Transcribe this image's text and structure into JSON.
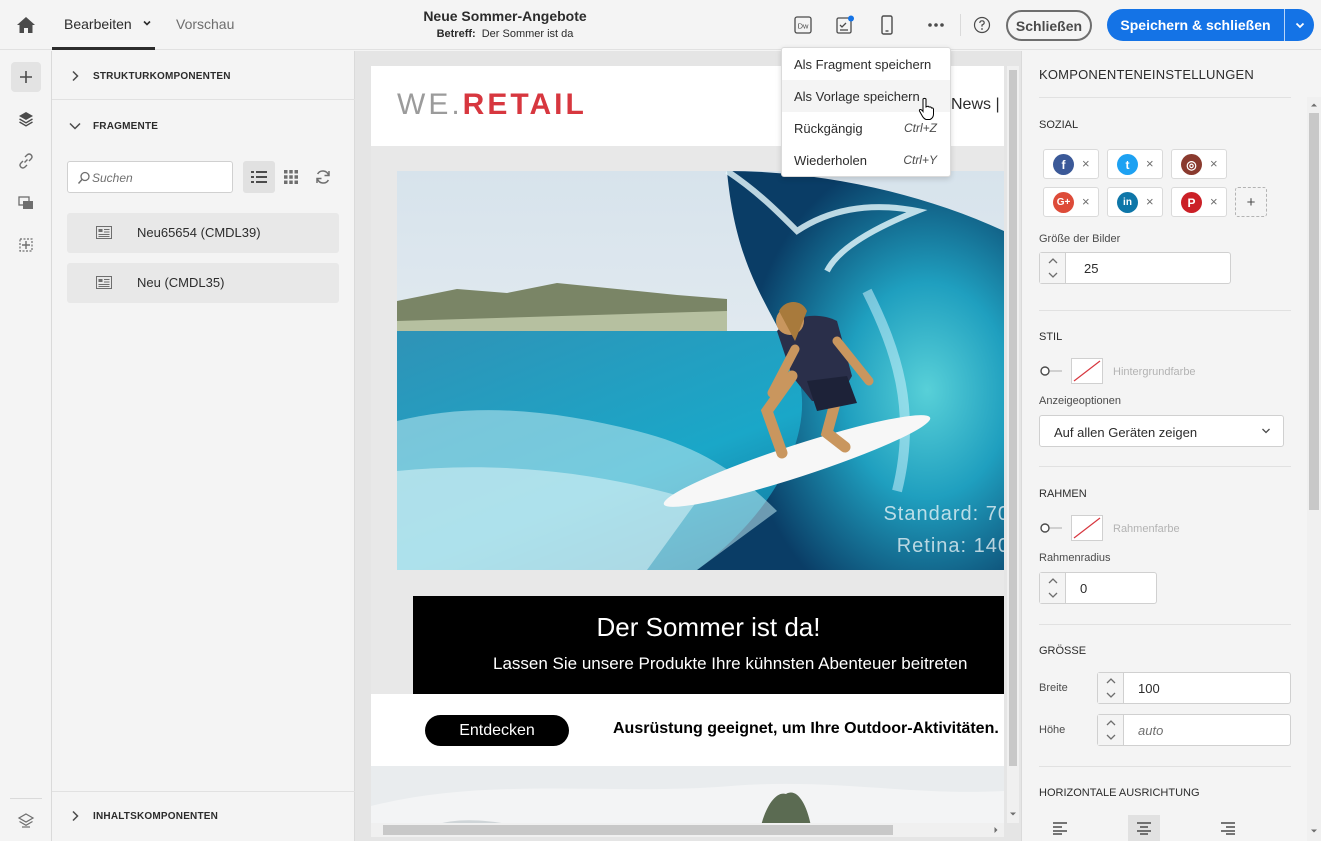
{
  "topbar": {
    "tab_edit": "Bearbeiten",
    "tab_preview": "Vorschau",
    "title": "Neue Sommer-Angebote",
    "subject_label": "Betreff:",
    "subject_value": "Der Sommer ist da",
    "dw_icon_text": "Dw",
    "close_label": "Schließen",
    "save_label": "Speichern & schließen",
    "accent": "#1473e6"
  },
  "left_panel": {
    "structure_heading": "STRUKTURKOMPONENTEN",
    "fragments_heading": "FRAGMENTE",
    "search_placeholder": "Suchen",
    "fragments": [
      {
        "label": "Neu65654 (CMDL39)"
      },
      {
        "label": "Neu (CMDL35)"
      }
    ],
    "content_heading": "INHALTSKOMPONENTEN"
  },
  "email": {
    "logo_left": "WE.",
    "logo_right": "RETAIL",
    "nav_text": "News |",
    "hero_text_1": "Standard: 70",
    "hero_text_2": "Retina: 140",
    "headline": "Der Sommer ist da!",
    "subline": "Lassen Sie unsere Produkte Ihre kühnsten Abenteuer beitreten",
    "cta_label": "Entdecken",
    "cta_description": "Ausrüstung geeignet, um Ihre Outdoor-Aktivitäten."
  },
  "menu": {
    "items": [
      {
        "label": "Als Fragment speichern",
        "shortcut": ""
      },
      {
        "label": "Als Vorlage speichern",
        "shortcut": ""
      },
      {
        "label": "Rückgängig",
        "shortcut": "Ctrl+Z"
      },
      {
        "label": "Wiederholen",
        "shortcut": "Ctrl+Y"
      }
    ]
  },
  "right_panel": {
    "title": "KOMPONENTENEINSTELLUNGEN",
    "social_heading": "SOZIAL",
    "social": [
      {
        "name": "facebook",
        "glyph": "f",
        "color": "#3b5998"
      },
      {
        "name": "twitter",
        "glyph": "t",
        "color": "#1da1f2"
      },
      {
        "name": "instagram",
        "glyph": "◎",
        "color": "#8a3a2e"
      },
      {
        "name": "google-plus",
        "glyph": "G+",
        "color": "#dd4b39"
      },
      {
        "name": "linkedin",
        "glyph": "in",
        "color": "#0e76a8"
      },
      {
        "name": "pinterest",
        "glyph": "P",
        "color": "#cb2027"
      }
    ],
    "social_add": "+",
    "image_size_label": "Größe der Bilder",
    "image_size_value": "25",
    "style_heading": "STIL",
    "bg_color_label": "Hintergrundfarbe",
    "display_options_label": "Anzeigeoptionen",
    "display_options_value": "Auf allen Geräten zeigen",
    "border_heading": "RAHMEN",
    "border_color_label": "Rahmenfarbe",
    "border_radius_label": "Rahmenradius",
    "border_radius_value": "0",
    "size_heading": "GRÖSSE",
    "width_label": "Breite",
    "width_value": "100",
    "height_label": "Höhe",
    "height_placeholder": "auto",
    "align_heading": "HORIZONTALE AUSRICHTUNG"
  }
}
